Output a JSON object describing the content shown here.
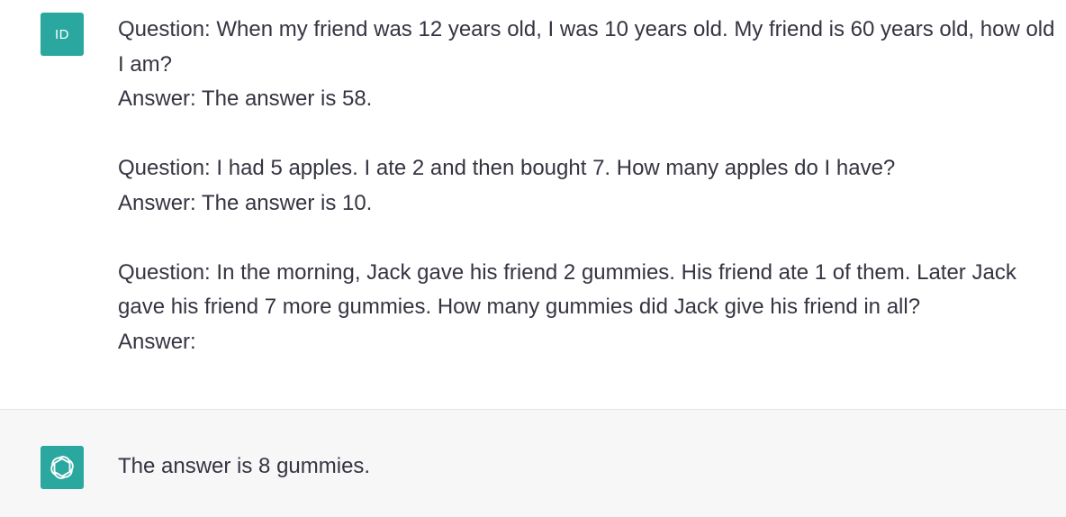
{
  "conversation": {
    "user_message": {
      "avatar_label": "ID",
      "blocks": [
        {
          "question": "Question: When my friend was 12 years old, I was 10 years old. My friend is 60 years old, how old I am?",
          "answer": "Answer: The answer is 58."
        },
        {
          "question": "Question: I had 5 apples. I ate 2 and then bought 7. How many apples do I have?",
          "answer": "Answer: The answer is 10."
        },
        {
          "question": "Question: In the morning, Jack gave his friend 2 gummies. His friend ate 1 of them. Later Jack gave his friend 7 more gummies. How many gummies did Jack give his friend in all?",
          "answer": "Answer:"
        }
      ]
    },
    "assistant_message": {
      "avatar_icon": "openai-logo-icon",
      "text": "The answer is 8 gummies."
    }
  },
  "colors": {
    "avatar_bg": "#2aa8a0",
    "assistant_bg": "#f7f7f8",
    "text": "#343541"
  }
}
